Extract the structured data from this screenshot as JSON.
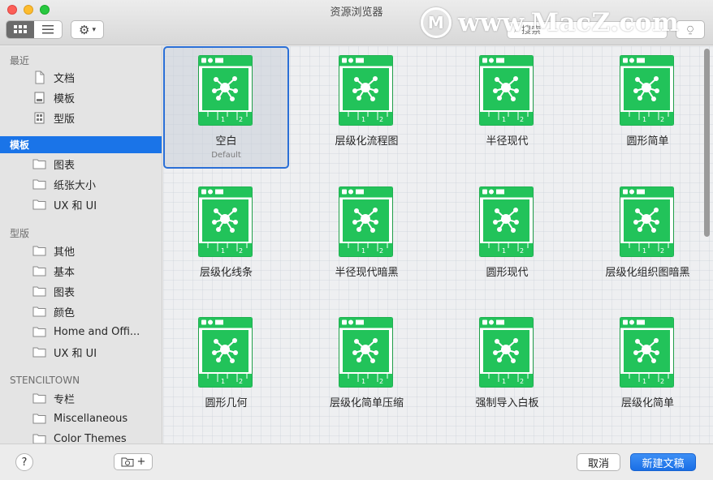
{
  "window": {
    "title": "资源浏览器"
  },
  "toolbar": {
    "view_grid_icon": "grid-icon",
    "view_list_icon": "list-icon",
    "gear_icon": "gear-icon",
    "search_placeholder": "搜索"
  },
  "watermark": {
    "logo": "M",
    "text": "www.MacZ.com"
  },
  "sidebar": {
    "sections": [
      {
        "title": "最近",
        "items": [
          {
            "label": "文档",
            "icon": "document-icon"
          },
          {
            "label": "模板",
            "icon": "template-icon"
          },
          {
            "label": "型版",
            "icon": "stencil-icon"
          }
        ]
      },
      {
        "title": "模板",
        "selected": true,
        "items": [
          {
            "label": "图表",
            "icon": "folder-icon"
          },
          {
            "label": "纸张大小",
            "icon": "folder-icon"
          },
          {
            "label": "UX 和 UI",
            "icon": "folder-icon"
          }
        ]
      },
      {
        "title": "型版",
        "items": [
          {
            "label": "其他",
            "icon": "folder-icon"
          },
          {
            "label": "基本",
            "icon": "folder-icon"
          },
          {
            "label": "图表",
            "icon": "folder-icon"
          },
          {
            "label": "颜色",
            "icon": "folder-icon"
          },
          {
            "label": "Home and Offi...",
            "icon": "folder-icon"
          },
          {
            "label": "UX 和 UI",
            "icon": "folder-icon"
          }
        ]
      },
      {
        "title": "STENCILTOWN",
        "items": [
          {
            "label": "专栏",
            "icon": "folder-icon"
          },
          {
            "label": "Miscellaneous",
            "icon": "folder-icon"
          },
          {
            "label": "Color Themes",
            "icon": "folder-icon"
          }
        ]
      }
    ]
  },
  "templates": [
    {
      "label": "空白",
      "sublabel": "Default",
      "selected": true
    },
    {
      "label": "层级化流程图"
    },
    {
      "label": "半径现代"
    },
    {
      "label": "圆形简单"
    },
    {
      "label": "层级化线条"
    },
    {
      "label": "半径现代暗黑"
    },
    {
      "label": "圆形现代"
    },
    {
      "label": "层级化组织图暗黑"
    },
    {
      "label": "圆形几何"
    },
    {
      "label": "层级化简单压缩"
    },
    {
      "label": "强制导入白板"
    },
    {
      "label": "层级化简单"
    }
  ],
  "template_icon": {
    "ruler_1": "1",
    "ruler_2": "2",
    "accent": "#22c35a"
  },
  "footer": {
    "help_label": "?",
    "add_label": "+",
    "cancel_label": "取消",
    "new_label": "新建文稿"
  }
}
